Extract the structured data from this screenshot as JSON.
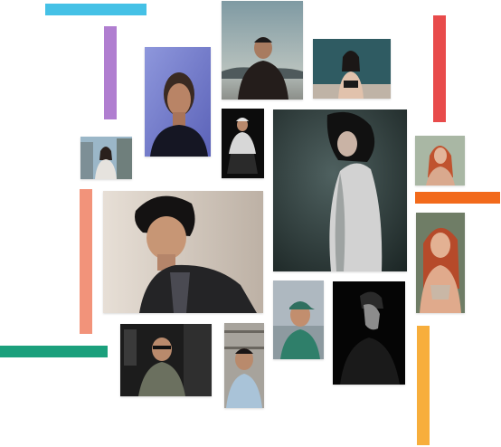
{
  "decorations": {
    "colors": {
      "cyan": "#45c1e6",
      "purple": "#b07ed0",
      "red": "#e84b4b",
      "orange": "#f26a1b",
      "salmon": "#f2937a",
      "green": "#1ba07c",
      "yellow": "#f7ae3c"
    }
  },
  "photos": [
    {
      "subject": "woman-blue-background-portrait"
    },
    {
      "subject": "man-by-lake-portrait"
    },
    {
      "subject": "woman-teal-wall-portrait"
    },
    {
      "subject": "man-cap-seated-portrait"
    },
    {
      "subject": "woman-white-robe-profile"
    },
    {
      "subject": "woman-city-street-portrait"
    },
    {
      "subject": "redhead-woman-outdoor-portrait"
    },
    {
      "subject": "man-blazer-looking-down"
    },
    {
      "subject": "redhead-woman-smiling-portrait"
    },
    {
      "subject": "man-green-cap-smiling"
    },
    {
      "subject": "man-dark-profile-portrait"
    },
    {
      "subject": "man-glasses-dark-room"
    },
    {
      "subject": "man-bookshelf-portrait"
    }
  ]
}
